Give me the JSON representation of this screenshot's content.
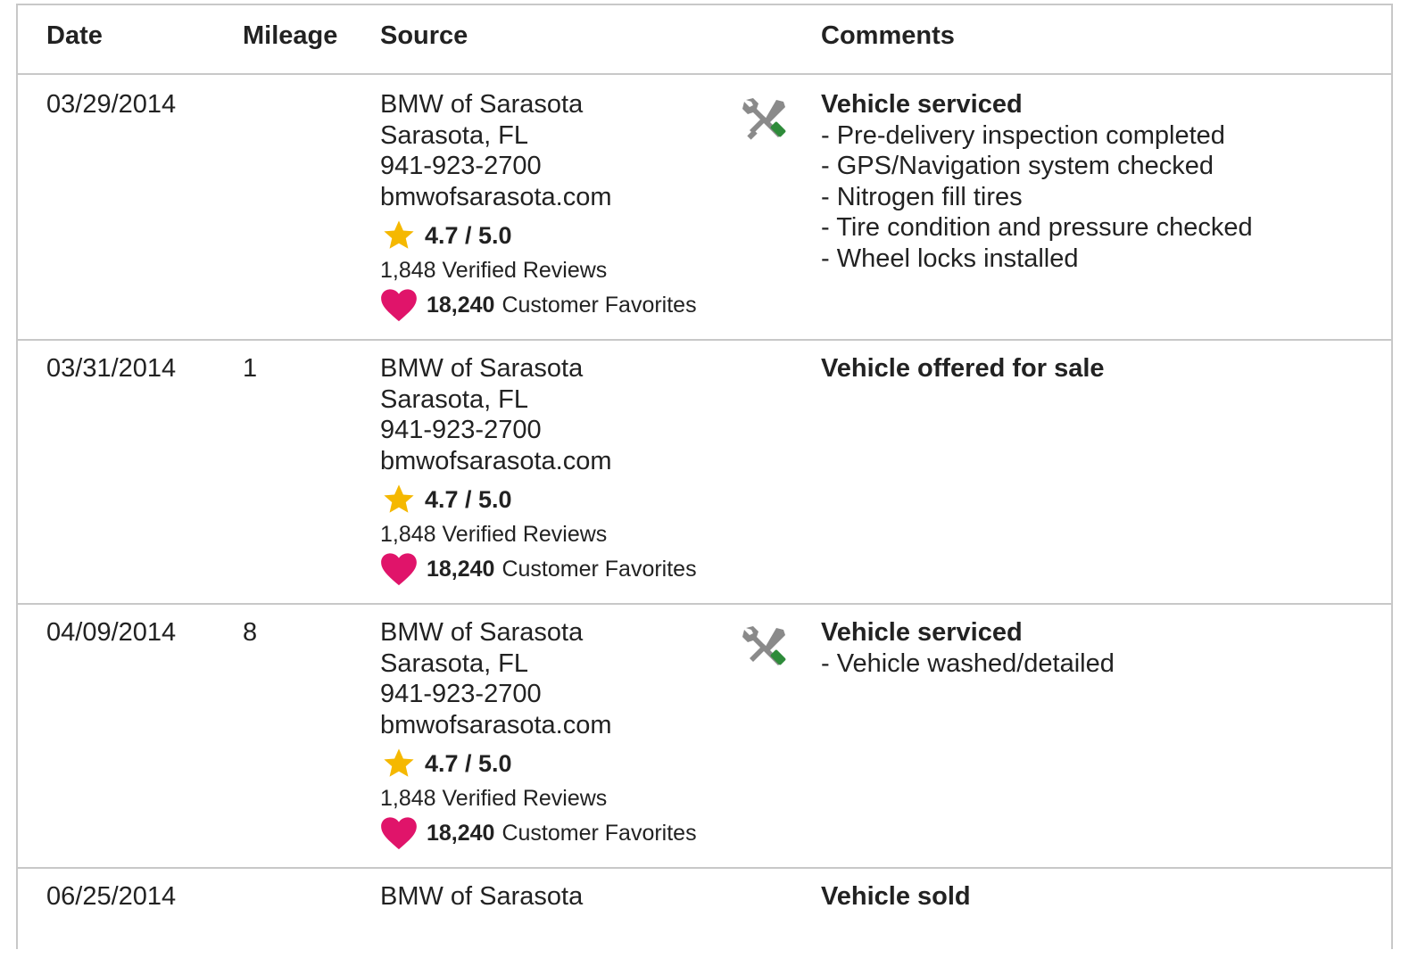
{
  "columns": {
    "date": "Date",
    "mileage": "Mileage",
    "source": "Source",
    "comments": "Comments"
  },
  "colors": {
    "star": "#f5b800",
    "heart": "#e0146a",
    "tool_gray": "#8a8a8a",
    "tool_green": "#2e8b3a",
    "border": "#c8c8c8"
  },
  "rows": [
    {
      "date": "03/29/2014",
      "mileage": "",
      "source": {
        "name": "BMW of Sarasota",
        "location": "Sarasota, FL",
        "phone": "941-923-2700",
        "website": "bmwofsarasota.com",
        "rating": "4.7 / 5.0",
        "reviews": "1,848 Verified Reviews",
        "favorites_count": "18,240",
        "favorites_label": "Customer Favorites"
      },
      "icon": "service-tools-icon",
      "comment_title": "Vehicle serviced",
      "comment_items": [
        "- Pre-delivery inspection completed",
        "- GPS/Navigation system checked",
        "- Nitrogen fill tires",
        "- Tire condition and pressure checked",
        "- Wheel locks installed"
      ]
    },
    {
      "date": "03/31/2014",
      "mileage": "1",
      "source": {
        "name": "BMW of Sarasota",
        "location": "Sarasota, FL",
        "phone": "941-923-2700",
        "website": "bmwofsarasota.com",
        "rating": "4.7 / 5.0",
        "reviews": "1,848 Verified Reviews",
        "favorites_count": "18,240",
        "favorites_label": "Customer Favorites"
      },
      "icon": "",
      "comment_title": "Vehicle offered for sale",
      "comment_items": []
    },
    {
      "date": "04/09/2014",
      "mileage": "8",
      "source": {
        "name": "BMW of Sarasota",
        "location": "Sarasota, FL",
        "phone": "941-923-2700",
        "website": "bmwofsarasota.com",
        "rating": "4.7 / 5.0",
        "reviews": "1,848 Verified Reviews",
        "favorites_count": "18,240",
        "favorites_label": "Customer Favorites"
      },
      "icon": "service-tools-icon",
      "comment_title": "Vehicle serviced",
      "comment_items": [
        "- Vehicle washed/detailed"
      ]
    },
    {
      "date": "06/25/2014",
      "mileage": "",
      "source": {
        "name": "BMW of Sarasota"
      },
      "icon": "",
      "comment_title": "Vehicle sold",
      "comment_items": []
    }
  ]
}
